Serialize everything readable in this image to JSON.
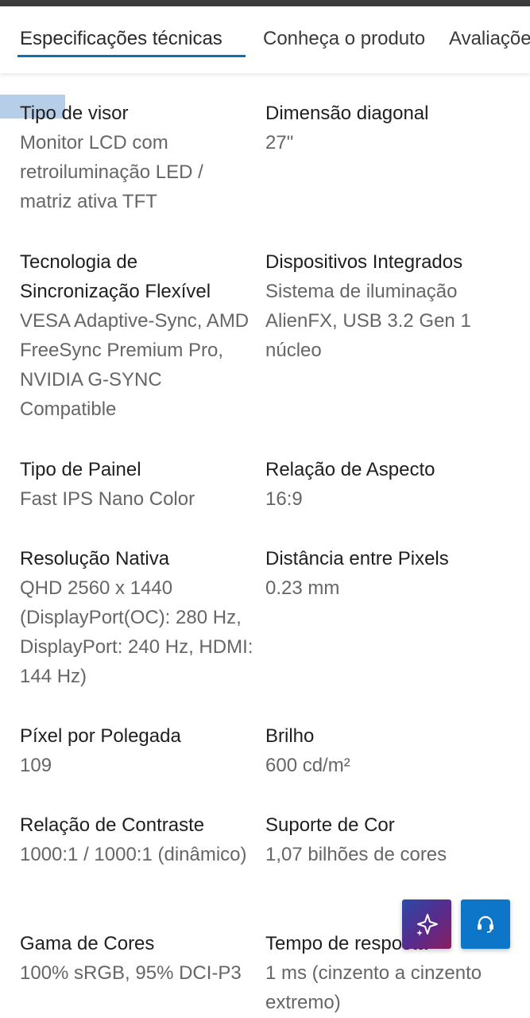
{
  "tabs": [
    {
      "label": "Especificações técnicas",
      "active": true
    },
    {
      "label": "Conheça o produto",
      "active": false
    },
    {
      "label": "Avaliações",
      "active": false
    }
  ],
  "specs": [
    {
      "label": "Tipo de visor",
      "value": "Monitor LCD com retroiluminação LED / matriz ativa TFT"
    },
    {
      "label": "Dimensão diagonal",
      "value": "27\""
    },
    {
      "label": "Tecnologia de Sincronização Flexível",
      "value": "VESA Adaptive-Sync, AMD FreeSync Premium Pro, NVIDIA G-SYNC Compatible"
    },
    {
      "label": "Dispositivos Integrados",
      "value": "Sistema de iluminação AlienFX, USB 3.2 Gen 1 núcleo"
    },
    {
      "label": "Tipo de Painel",
      "value": "Fast IPS Nano Color"
    },
    {
      "label": "Relação de Aspecto",
      "value": "16:9"
    },
    {
      "label": "Resolução Nativa",
      "value": "QHD 2560 x 1440 (DisplayPort(OC): 280 Hz, DisplayPort: 240 Hz, HDMI: 144 Hz)"
    },
    {
      "label": "Distância entre Pixels",
      "value": "0.23 mm"
    },
    {
      "label": "Píxel por Polegada",
      "value": "109"
    },
    {
      "label": "Brilho",
      "value": "600 cd/m²"
    },
    {
      "label": "Relação de Contraste",
      "value": "1000:1 / 1000:1 (dinâmico)"
    },
    {
      "label": "Suporte de Cor",
      "value": "1,07 bilhões de cores"
    },
    {
      "label": "Gama de Cores",
      "value": "100% sRGB, 95% DCI-P3"
    },
    {
      "label": "Tempo de resposta",
      "value": "1 ms (cinzento a cinzento extremo)"
    }
  ],
  "floating_buttons": {
    "ai_icon": "sparkle-icon",
    "help_icon": "headset-icon"
  },
  "colors": {
    "accent": "#0e6fb3",
    "help_button": "#0e76c8",
    "label_text": "#1f1f1f",
    "value_text": "#666666"
  }
}
